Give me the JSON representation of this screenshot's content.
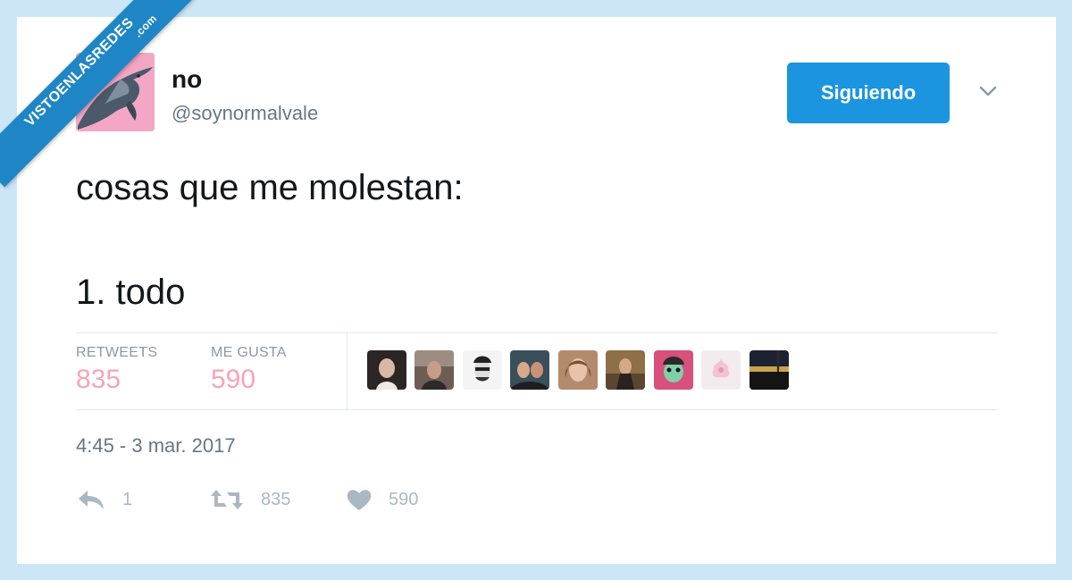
{
  "watermark": {
    "text": "VISTOENLASREDES",
    "sub": ".com"
  },
  "user": {
    "display_name": "no",
    "handle": "@soynormalvale"
  },
  "follow_button_label": "Siguiendo",
  "tweet": {
    "line1": "cosas que me molestan:",
    "line2": "1. todo"
  },
  "stats": {
    "retweets_label": "RETWEETS",
    "retweets_count": "835",
    "likes_label": "ME GUSTA",
    "likes_count": "590"
  },
  "likers_count": 9,
  "timestamp": "4:45 - 3 mar. 2017",
  "actions": {
    "reply_count": "1",
    "retweet_count": "835",
    "like_count": "590"
  },
  "colors": {
    "accent": "#1b95e0",
    "stat_numbers": "#f6a5b5",
    "muted_text": "#657786",
    "action_icons": "#aab8c2",
    "watermark": "#1f86c6",
    "avatar_bg": "#f4a7c4"
  },
  "icons": [
    "chevron-down-icon",
    "reply-icon",
    "retweet-icon",
    "heart-icon"
  ]
}
